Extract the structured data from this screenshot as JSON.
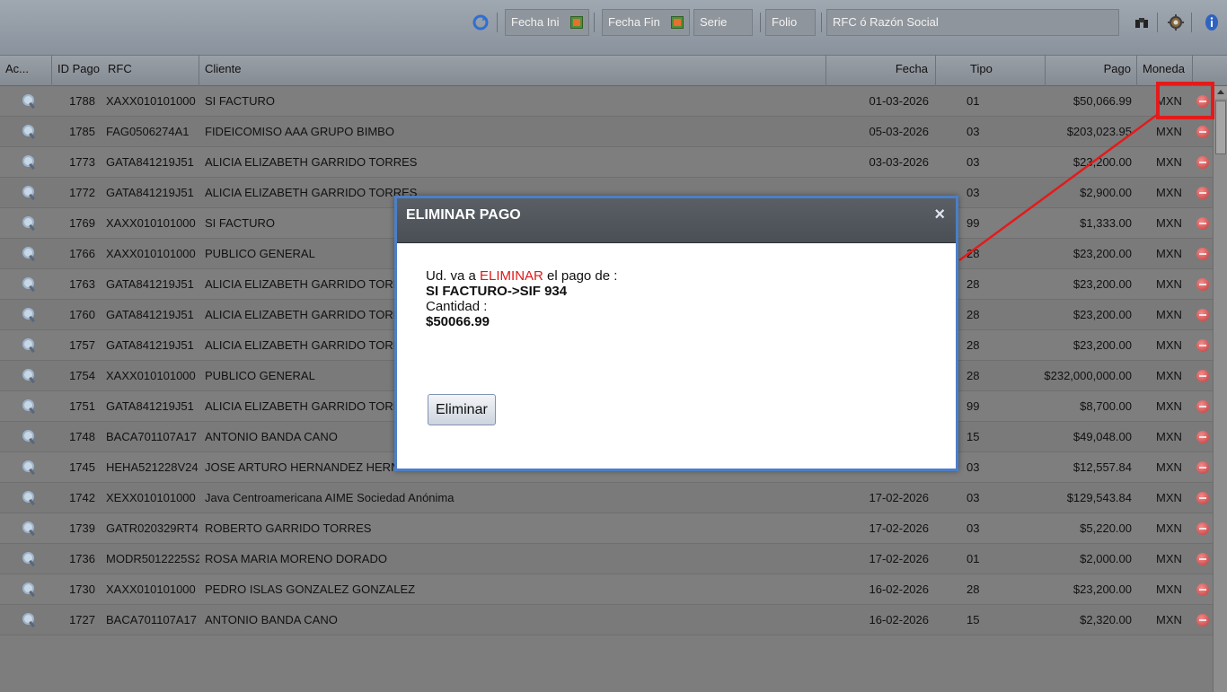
{
  "toolbar": {
    "fecha_ini": "Fecha Ini",
    "fecha_fin": "Fecha Fin",
    "serie": "Serie",
    "folio": "Folio",
    "rfc_placeholder": "RFC ó Razón Social",
    "icons": [
      "refresh-icon",
      "calendar-icon",
      "binoculars-icon",
      "settings-icon",
      "info-icon"
    ]
  },
  "table": {
    "headers": {
      "acciones": "Ac...",
      "id_pago": "ID Pago",
      "rfc": "RFC",
      "cliente": "Cliente",
      "fecha": "Fecha",
      "tipo": "Tipo",
      "pago": "Pago",
      "moneda": "Moneda"
    },
    "rows": [
      {
        "id": "1788",
        "rfc": "XAXX010101000",
        "cliente": "SI FACTURO",
        "fecha": "01-03-2026",
        "tipo": "01",
        "pago": "$50,066.99",
        "moneda": "MXN"
      },
      {
        "id": "1785",
        "rfc": "FAG0506274A1",
        "cliente": "FIDEICOMISO AAA GRUPO BIMBO",
        "fecha": "05-03-2026",
        "tipo": "03",
        "pago": "$203,023.95",
        "moneda": "MXN"
      },
      {
        "id": "1773",
        "rfc": "GATA841219J51",
        "cliente": "ALICIA ELIZABETH GARRIDO TORRES",
        "fecha": "03-03-2026",
        "tipo": "03",
        "pago": "$23,200.00",
        "moneda": "MXN"
      },
      {
        "id": "1772",
        "rfc": "GATA841219J51",
        "cliente": "ALICIA ELIZABETH GARRIDO TORRES",
        "fecha": "",
        "tipo": "03",
        "pago": "$2,900.00",
        "moneda": "MXN"
      },
      {
        "id": "1769",
        "rfc": "XAXX010101000",
        "cliente": "SI FACTURO",
        "fecha": "",
        "tipo": "99",
        "pago": "$1,333.00",
        "moneda": "MXN"
      },
      {
        "id": "1766",
        "rfc": "XAXX010101000",
        "cliente": "PUBLICO GENERAL",
        "fecha": "",
        "tipo": "28",
        "pago": "$23,200.00",
        "moneda": "MXN"
      },
      {
        "id": "1763",
        "rfc": "GATA841219J51",
        "cliente": "ALICIA ELIZABETH GARRIDO TORRES",
        "fecha": "",
        "tipo": "28",
        "pago": "$23,200.00",
        "moneda": "MXN"
      },
      {
        "id": "1760",
        "rfc": "GATA841219J51",
        "cliente": "ALICIA ELIZABETH GARRIDO TORRES",
        "fecha": "",
        "tipo": "28",
        "pago": "$23,200.00",
        "moneda": "MXN"
      },
      {
        "id": "1757",
        "rfc": "GATA841219J51",
        "cliente": "ALICIA ELIZABETH GARRIDO TORRES",
        "fecha": "",
        "tipo": "28",
        "pago": "$23,200.00",
        "moneda": "MXN"
      },
      {
        "id": "1754",
        "rfc": "XAXX010101000",
        "cliente": "PUBLICO GENERAL",
        "fecha": "",
        "tipo": "28",
        "pago": "$232,000,000.00",
        "moneda": "MXN"
      },
      {
        "id": "1751",
        "rfc": "GATA841219J51",
        "cliente": "ALICIA ELIZABETH GARRIDO TORRES",
        "fecha": "",
        "tipo": "99",
        "pago": "$8,700.00",
        "moneda": "MXN"
      },
      {
        "id": "1748",
        "rfc": "BACA701107A17",
        "cliente": "ANTONIO BANDA CANO",
        "fecha": "",
        "tipo": "15",
        "pago": "$49,048.00",
        "moneda": "MXN"
      },
      {
        "id": "1745",
        "rfc": "HEHA521228V24",
        "cliente": "JOSE ARTURO HERNANDEZ HERNANDEZ",
        "fecha": "28-02-2026",
        "tipo": "03",
        "pago": "$12,557.84",
        "moneda": "MXN"
      },
      {
        "id": "1742",
        "rfc": "XEXX010101000",
        "cliente": "Java Centroamericana AIME Sociedad Anónima",
        "fecha": "17-02-2026",
        "tipo": "03",
        "pago": "$129,543.84",
        "moneda": "MXN"
      },
      {
        "id": "1739",
        "rfc": "GATR020329RT4",
        "cliente": "ROBERTO GARRIDO TORRES",
        "fecha": "17-02-2026",
        "tipo": "03",
        "pago": "$5,220.00",
        "moneda": "MXN"
      },
      {
        "id": "1736",
        "rfc": "MODR5012225S2",
        "cliente": "ROSA MARIA MORENO DORADO",
        "fecha": "17-02-2026",
        "tipo": "01",
        "pago": "$2,000.00",
        "moneda": "MXN"
      },
      {
        "id": "1730",
        "rfc": "XAXX010101000",
        "cliente": "PEDRO ISLAS GONZALEZ GONZALEZ",
        "fecha": "16-02-2026",
        "tipo": "28",
        "pago": "$23,200.00",
        "moneda": "MXN"
      },
      {
        "id": "1727",
        "rfc": "BACA701107A17",
        "cliente": "ANTONIO BANDA CANO",
        "fecha": "16-02-2026",
        "tipo": "15",
        "pago": "$2,320.00",
        "moneda": "MXN"
      }
    ]
  },
  "modal": {
    "title": "ELIMINAR PAGO",
    "close": "×",
    "line1_prefix": "Ud. va a ",
    "line1_highlight": "ELIMINAR",
    "line1_suffix": " el pago de :",
    "line2": "SI FACTURO->SIF 934",
    "line3": "Cantidad :",
    "line4": "$50066.99",
    "button": "Eliminar"
  },
  "colors": {
    "highlight": "#e31b1b",
    "modal_border": "#4b7fc7"
  }
}
